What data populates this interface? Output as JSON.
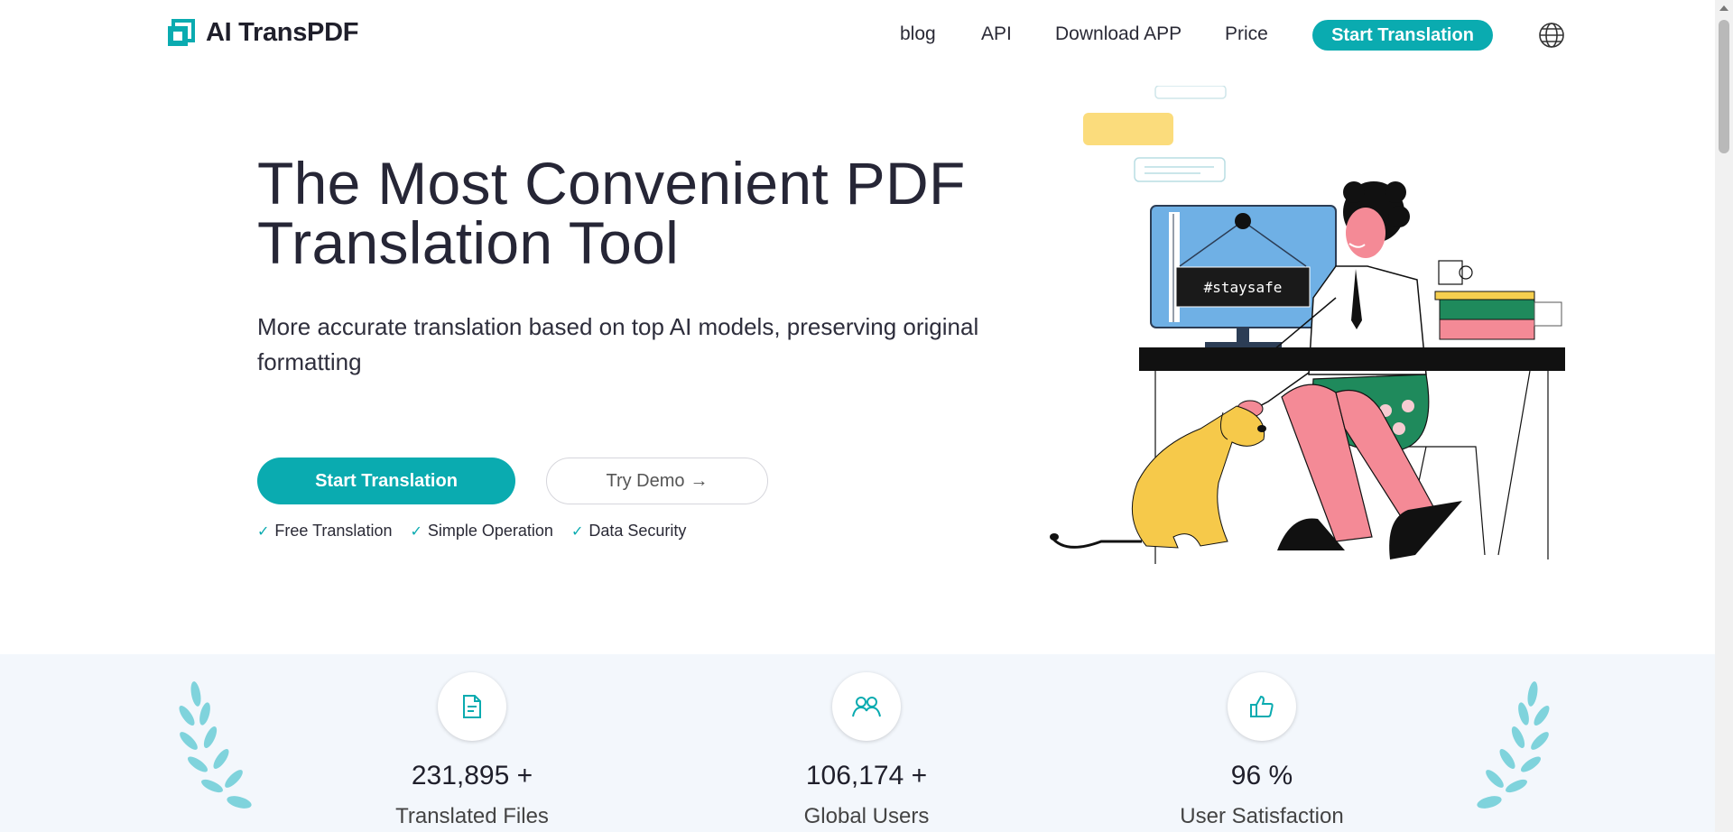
{
  "header": {
    "logo_text": "AI TransPDF",
    "nav": [
      "blog",
      "API",
      "Download APP",
      "Price"
    ],
    "cta_label": "Start Translation",
    "language_icon": "globe-icon"
  },
  "hero": {
    "title_line1": "The Most Convenient PDF",
    "title_line2": "Translation Tool",
    "subtitle": "More accurate translation based on top AI models, preserving original formatting",
    "primary_button": "Start Translation",
    "secondary_button": "Try Demo",
    "secondary_button_arrow": "→",
    "features": [
      "Free Translation",
      "Simple Operation",
      "Data Security"
    ],
    "illustration_sign": "#staysafe"
  },
  "stats": [
    {
      "icon": "document-icon",
      "value": "231,895 +",
      "label": "Translated Files"
    },
    {
      "icon": "users-icon",
      "value": "106,174 +",
      "label": "Global Users"
    },
    {
      "icon": "thumbs-up-icon",
      "value": "96 %",
      "label": "User Satisfaction"
    }
  ],
  "colors": {
    "accent": "#0aabb0",
    "stats_background": "#f3f7fc",
    "laurel": "#7fd3dc"
  }
}
